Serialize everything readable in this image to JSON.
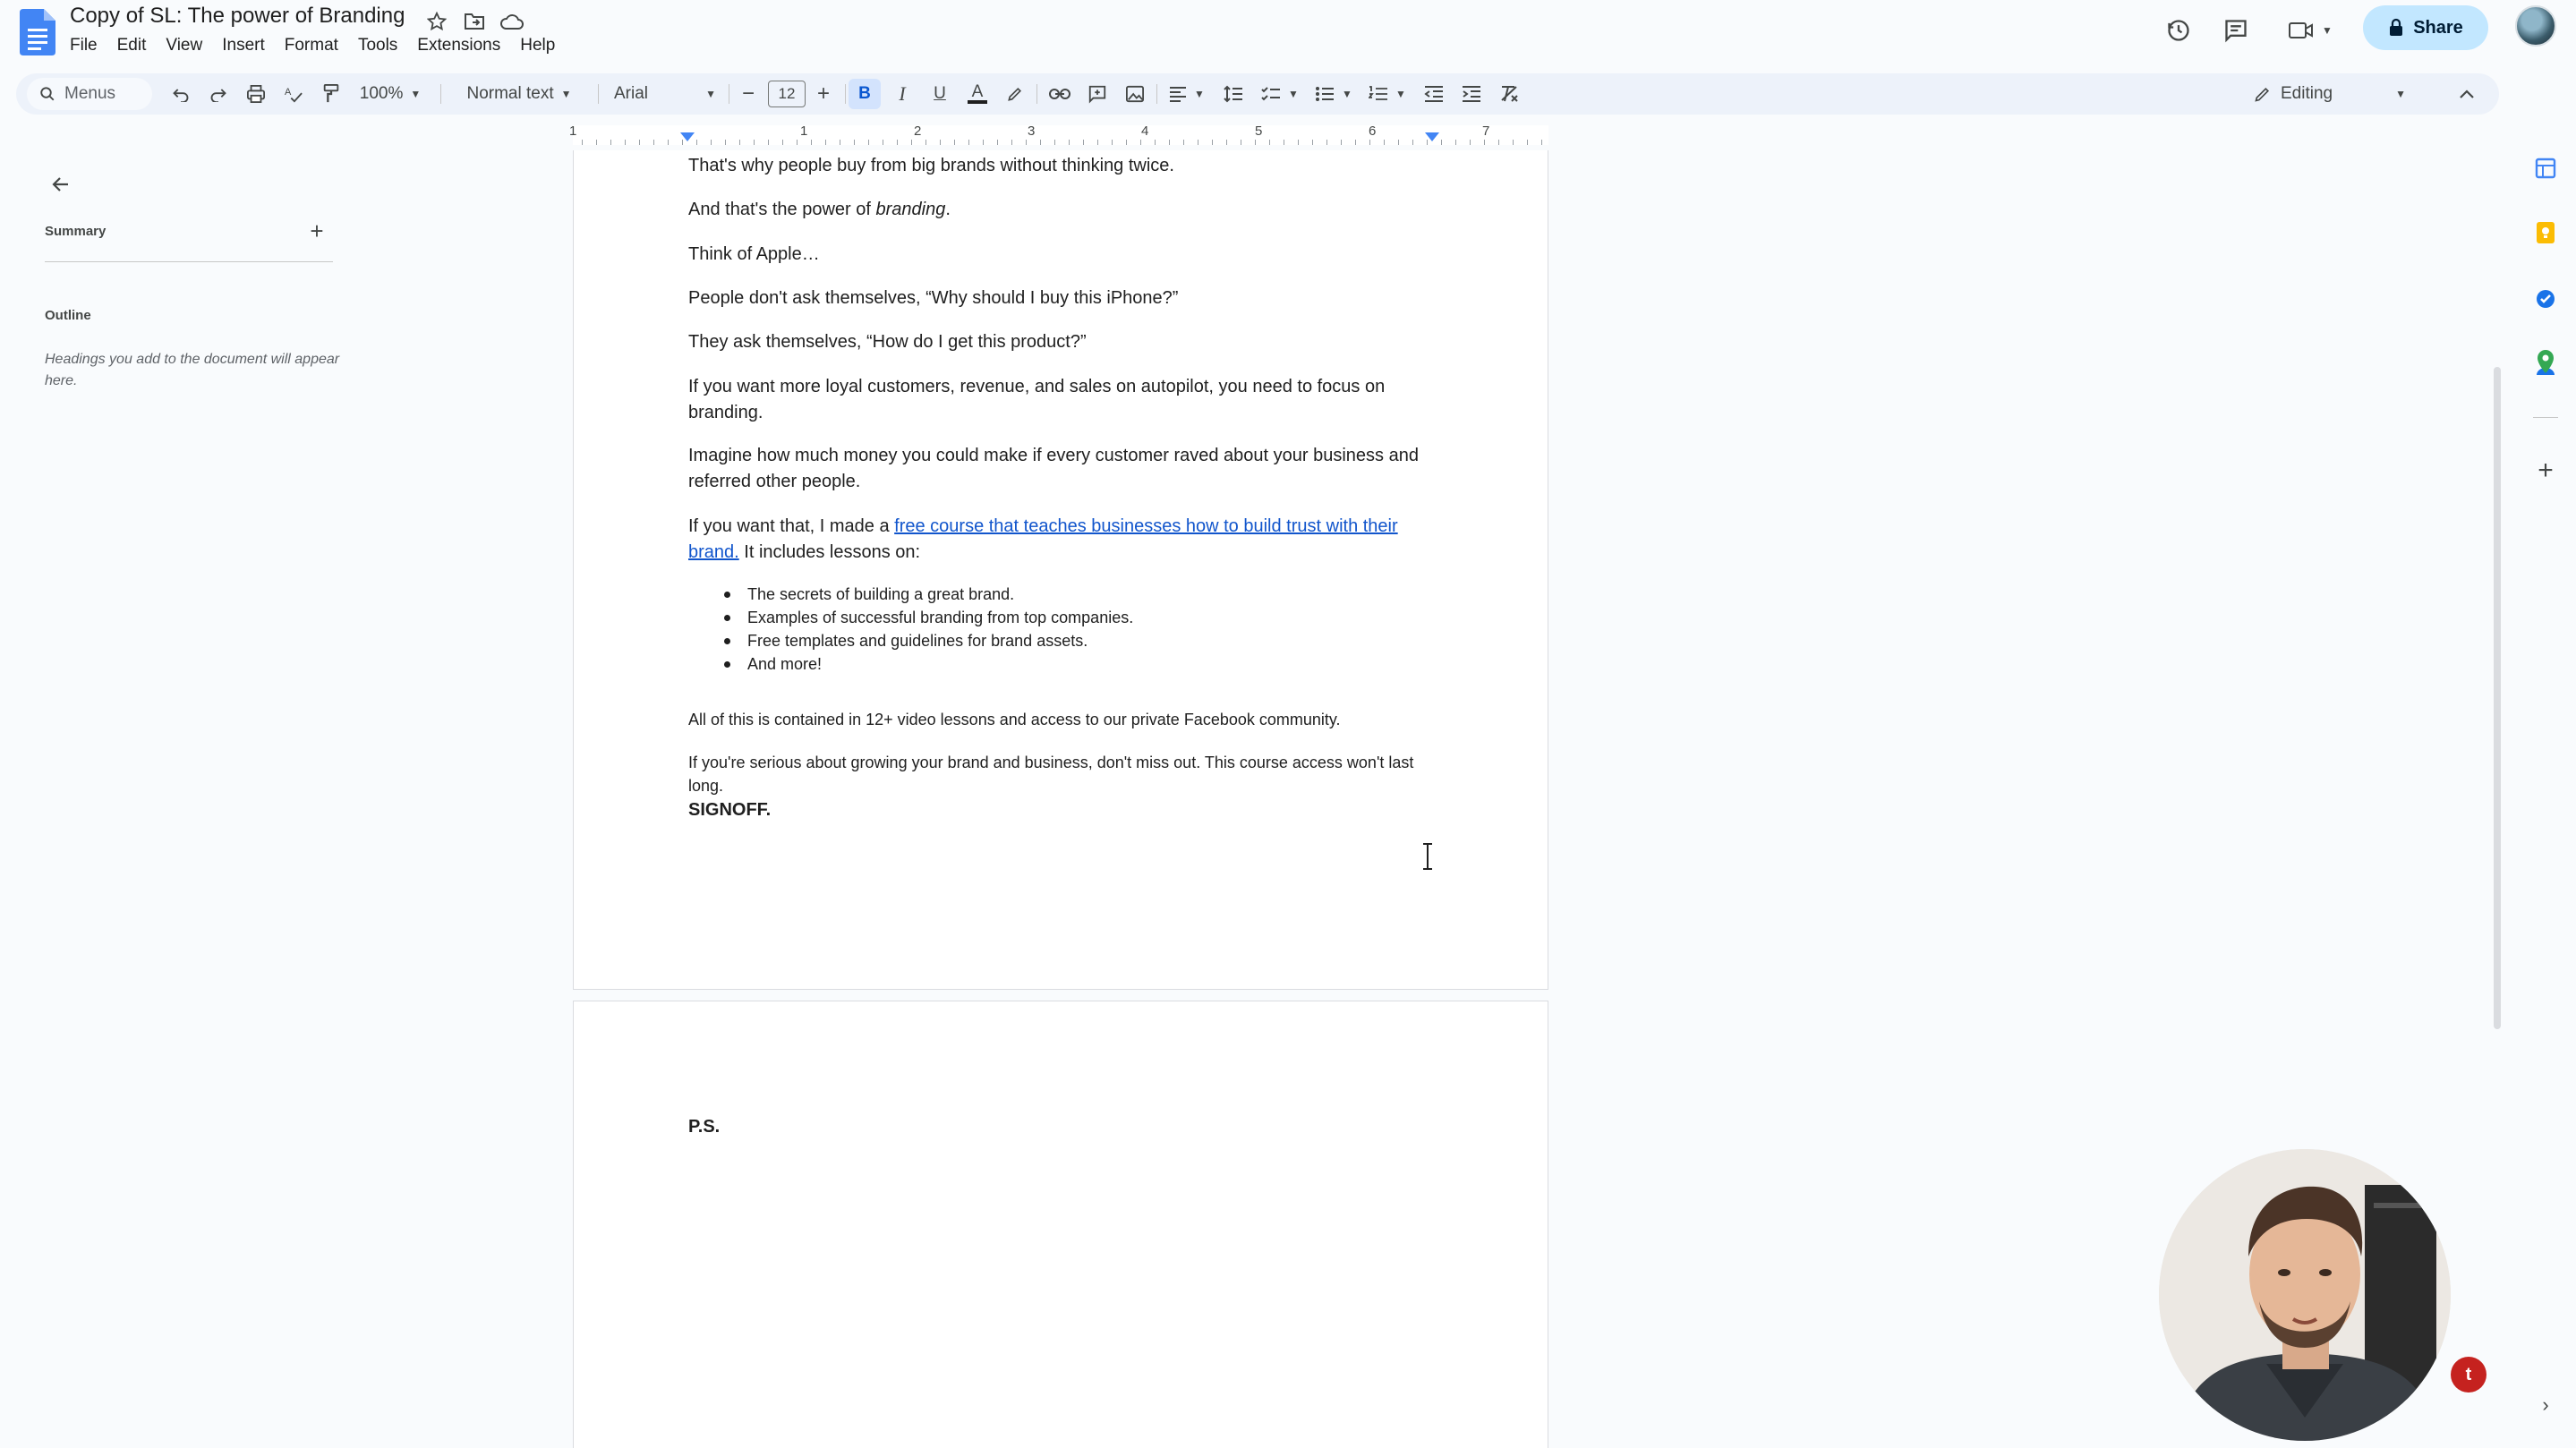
{
  "app": {
    "document_title": "Copy of SL: The power of Branding",
    "menu": [
      "File",
      "Edit",
      "View",
      "Insert",
      "Format",
      "Tools",
      "Extensions",
      "Help"
    ],
    "share_label": "Share"
  },
  "toolbar": {
    "search_label": "Menus",
    "zoom": "100%",
    "style": "Normal text",
    "font": "Arial",
    "font_size": "12",
    "bold": "B",
    "italic": "I",
    "underline": "U",
    "text_color": "A",
    "mode": "Editing"
  },
  "ruler": {
    "numbers": [
      "1",
      "1",
      "2",
      "3",
      "4",
      "5",
      "6",
      "7"
    ]
  },
  "sidebar": {
    "summary_label": "Summary",
    "outline_label": "Outline",
    "outline_hint": "Headings you add to the document will appear here."
  },
  "document": {
    "p1": "That's why people buy from big brands without thinking twice.",
    "p2_prefix": "And that's the power of ",
    "p2_italic": "branding",
    "p2_suffix": ".",
    "p3": "Think of Apple…",
    "p4": "People don't ask themselves, “Why should I buy this iPhone?”",
    "p5": "They ask themselves, “How do I get this product?”",
    "p6": "If you want more loyal customers, revenue, and sales on autopilot, you need to focus on branding.",
    "p7": "Imagine how much money you could make if every customer raved about your business and referred other people.",
    "p8_prefix": "If you want that, I made a ",
    "p8_link": "free course that teaches businesses how to build trust with their brand.",
    "p8_suffix": " It includes lessons on:",
    "bullets": [
      "The secrets of building a great brand.",
      "Examples of successful branding from top companies.",
      "Free templates and guidelines for brand assets.",
      "And more!"
    ],
    "p9": "All of this is contained in 12+ video lessons and access to our private Facebook community.",
    "p10": "If you're serious about growing your brand and business, don't miss out. This course access won't last long.",
    "signoff": "SIGNOFF.",
    "ps": "P.S."
  },
  "colors": {
    "share_bg": "#c2e7ff",
    "toolbar_bg": "#edf2fa",
    "link": "#1155cc",
    "docs_blue": "#4285f4"
  }
}
